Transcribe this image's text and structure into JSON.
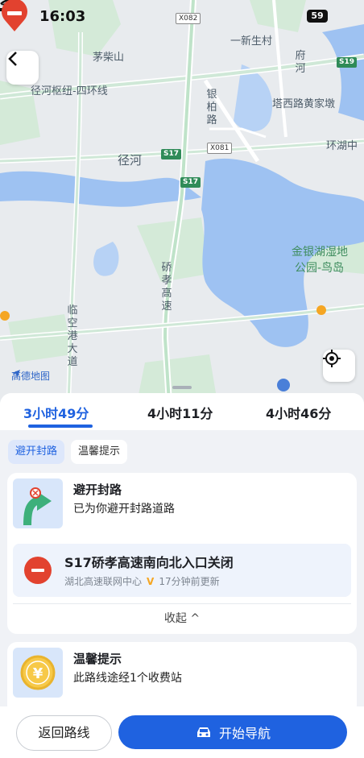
{
  "status_bar": {
    "time": "16:03",
    "battery": "59"
  },
  "map": {
    "labels": {
      "maochaishan": "茅柴山",
      "jinghe_hub": "径河枢纽-四环线",
      "yixinshengcun": "一新生村",
      "yinbailu": "银柏路",
      "taxilu": "塔西路黄家墩",
      "jinghe": "径河",
      "huanhu": "环湖中",
      "jinyinhu": "金银湖湿地",
      "gongyuan": "公园-鸟岛",
      "qiaoxiao": "硚孝高速",
      "linkong": "临空港大道",
      "fuhe": "府河"
    },
    "badges": {
      "x082": "X082",
      "x081": "X081",
      "s19": "S19",
      "s17a": "S17",
      "s17b": "S17"
    },
    "logo": "高德地图"
  },
  "routes": {
    "tabs": [
      {
        "label": "3小时49分",
        "active": true
      },
      {
        "label": "4小时11分",
        "active": false
      },
      {
        "label": "4小时46分",
        "active": false
      }
    ]
  },
  "chips": {
    "active": "避开封路",
    "other": "温馨提示"
  },
  "avoid_card": {
    "title": "避开封路",
    "subtitle": "已为你避开封路道路",
    "notice": {
      "title": "S17硚孝高速南向北入口关闭",
      "source": "湖北高速联网中心",
      "verified": "V",
      "updated": "17分钟前更新"
    },
    "collapse": "收起 ^"
  },
  "tips_card": {
    "title": "温馨提示",
    "subtitle": "此路线途经1个收费站",
    "icon_glyph": "¥"
  },
  "bottom": {
    "back": "返回路线",
    "start": "开始导航"
  },
  "colors": {
    "accent": "#1f62e0",
    "danger": "#e2422f",
    "water": "#9ec2f2",
    "green": "#cfe9d4"
  }
}
